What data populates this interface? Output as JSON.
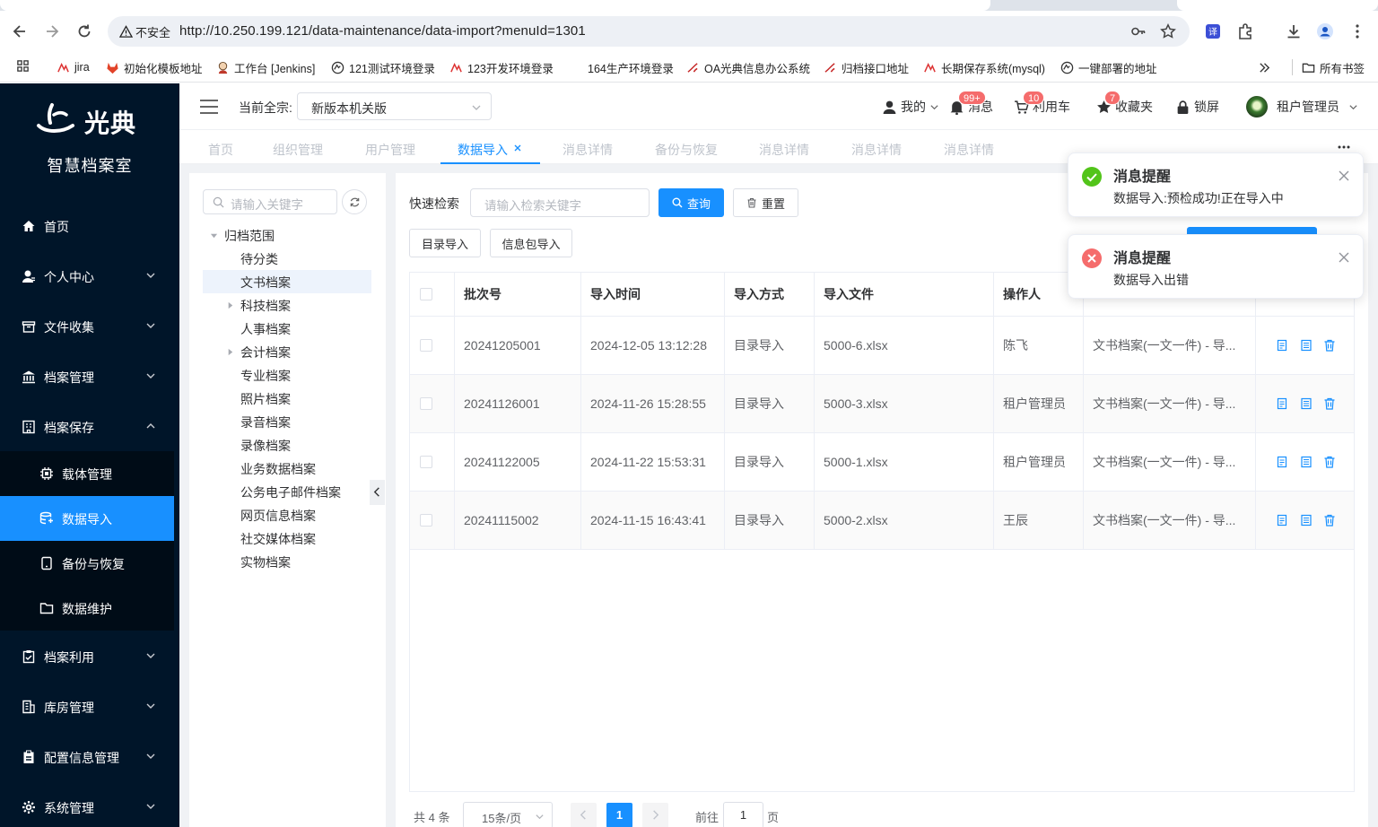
{
  "browser": {
    "insecure_label": "不安全",
    "url": "http://10.250.199.121/data-maintenance/data-import?menuId=1301",
    "bookmarks": [
      {
        "label": "jira"
      },
      {
        "label": "初始化模板地址"
      },
      {
        "label": "工作台 [Jenkins]"
      },
      {
        "label": "121测试环境登录"
      },
      {
        "label": "123开发环境登录"
      },
      {
        "label": "164生产环境登录"
      },
      {
        "label": "OA光典信息办公系统"
      },
      {
        "label": "归档接口地址"
      },
      {
        "label": "长期保存系统(mysql)"
      },
      {
        "label": "一键部署的地址"
      }
    ],
    "all_bookmarks": "所有书签"
  },
  "sidebar": {
    "logo_text": "光典",
    "subtitle": "智慧档案室",
    "items": [
      {
        "label": "首页",
        "icon": "home-icon"
      },
      {
        "label": "个人中心",
        "icon": "user-icon"
      },
      {
        "label": "文件收集",
        "icon": "box-icon"
      },
      {
        "label": "档案管理",
        "icon": "bank-icon"
      },
      {
        "label": "档案保存",
        "icon": "building-icon"
      },
      {
        "label": "档案利用",
        "icon": "clipboard-check-icon"
      },
      {
        "label": "库房管理",
        "icon": "warehouse-icon"
      },
      {
        "label": "配置信息管理",
        "icon": "clipboard-icon"
      },
      {
        "label": "系统管理",
        "icon": "gear-icon"
      }
    ],
    "submenu": [
      {
        "label": "载体管理",
        "icon": "chip-icon"
      },
      {
        "label": "数据导入",
        "icon": "database-icon"
      },
      {
        "label": "备份与恢复",
        "icon": "device-icon"
      },
      {
        "label": "数据维护",
        "icon": "folder-icon"
      }
    ]
  },
  "header": {
    "section_label": "当前全宗:",
    "section_value": "新版本机关版",
    "mine": "我的",
    "messages": "消息",
    "messages_badge": "99+",
    "cart": "利用车",
    "cart_badge": "10",
    "favorites": "收藏夹",
    "favorites_badge": "7",
    "lock": "锁屏",
    "user": "租户管理员"
  },
  "tabs": [
    "首页",
    "组织管理",
    "用户管理",
    "数据导入",
    "消息详情",
    "备份与恢复",
    "消息详情",
    "消息详情",
    "消息详情"
  ],
  "tree": {
    "placeholder": "请输入关键字",
    "root": "归档范围",
    "nodes": [
      "待分类",
      "文书档案",
      "科技档案",
      "人事档案",
      "会计档案",
      "专业档案",
      "照片档案",
      "录音档案",
      "录像档案",
      "业务数据档案",
      "公务电子邮件档案",
      "网页信息档案",
      "社交媒体档案",
      "实物档案"
    ]
  },
  "search": {
    "label": "快速检索",
    "placeholder": "请输入检索关键字",
    "query_btn": "查询",
    "reset_btn": "重置",
    "catalog_import": "目录导入",
    "package_import": "信息包导入"
  },
  "table": {
    "headers": [
      "批次号",
      "导入时间",
      "导入方式",
      "导入文件",
      "操作人"
    ],
    "rows": [
      {
        "batch": "20241205001",
        "time": "2024-12-05 13:12:28",
        "method": "目录导入",
        "file": "5000-6.xlsx",
        "operator": "陈飞",
        "target": "文书档案(一文一件) - 导..."
      },
      {
        "batch": "20241126001",
        "time": "2024-11-26 15:28:55",
        "method": "目录导入",
        "file": "5000-3.xlsx",
        "operator": "租户管理员",
        "target": "文书档案(一文一件) - 导..."
      },
      {
        "batch": "20241122005",
        "time": "2024-11-22 15:53:31",
        "method": "目录导入",
        "file": "5000-1.xlsx",
        "operator": "租户管理员",
        "target": "文书档案(一文一件) - 导..."
      },
      {
        "batch": "20241115002",
        "time": "2024-11-15 16:43:41",
        "method": "目录导入",
        "file": "5000-2.xlsx",
        "operator": "王辰",
        "target": "文书档案(一文一件) - 导..."
      }
    ]
  },
  "pagination": {
    "total": "共 4 条",
    "page_size": "15条/页",
    "current": "1",
    "goto_label": "前往",
    "goto_value": "1",
    "unit": "页"
  },
  "notifications": [
    {
      "type": "success",
      "title": "消息提醒",
      "message": "数据导入:预检成功!正在导入中"
    },
    {
      "type": "error",
      "title": "消息提醒",
      "message": "数据导入出错"
    }
  ],
  "colors": {
    "primary": "#1890ff",
    "sidebar": "#001529",
    "success": "#52c41a",
    "danger": "#f56c6c"
  }
}
